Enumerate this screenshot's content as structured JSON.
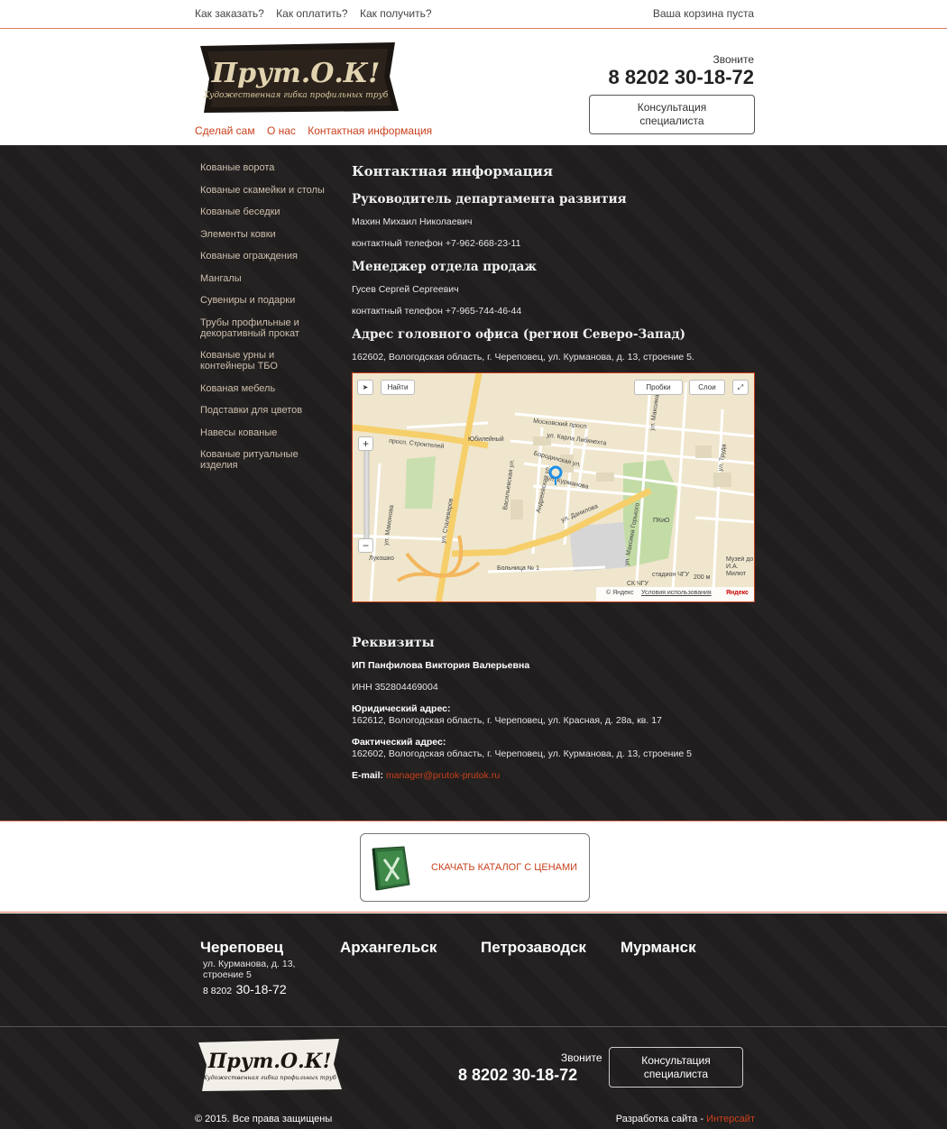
{
  "topbar": {
    "links": [
      "Как заказать?",
      "Как оплатить?",
      "Как получить?"
    ],
    "cart": "Ваша корзина пуста"
  },
  "header": {
    "logo_text": "Прут.О.К!",
    "logo_subtitle": "Художественная гибка профильных труб",
    "nav": [
      "Сделай сам",
      "О нас",
      "Контактная информация"
    ],
    "call_label": "Звоните",
    "phone": "8 8202 30-18-72",
    "consult_line1": "Консультация",
    "consult_line2": "специалиста"
  },
  "sidebar": {
    "items": [
      "Кованые ворота",
      "Кованые скамейки и столы",
      "Кованые беседки",
      "Элементы ковки",
      "Кованые ограждения",
      "Мангалы",
      "Сувениры и подарки",
      "Трубы профильные и декоративный прокат",
      "Кованые урны и контейнеры ТБО",
      "Кованая мебель",
      "Подставки для цветов",
      "Навесы кованые",
      "Кованые ритуальные изделия"
    ]
  },
  "content": {
    "title": "Контактная информация",
    "h_dev": "Руководитель департамента развития",
    "dev_name": "Махин Михаил Николаевич",
    "dev_phone": "контактный телефон +7-962-668-23-11",
    "h_sales": "Менеджер отдела продаж",
    "sales_name": "Гусев Сергей Сергеевич",
    "sales_phone": "контактный телефон +7-965-744-46-44",
    "h_address": "Адрес головного офиса (регион Северо-Запад)",
    "address": "162602, Вологодская область, г. Череповец, ул. Курманова, д. 13, строение 5.",
    "h_req": "Реквизиты",
    "req_name": "ИП Панфилова Виктория Валерьевна",
    "req_inn": "ИНН 352804469004",
    "req_legal_label": "Юридический адрес:",
    "req_legal": "162612, Вологодская область, г. Череповец, ул. Красная, д. 28а, кв. 17",
    "req_actual_label": "Фактический адрес:",
    "req_actual": "162602, Вологодская область, г. Череповец, ул. Курманова, д. 13, строение 5",
    "email_label": "E-mail:",
    "email": "manager@prutok-prutok.ru"
  },
  "map": {
    "find_btn": "Найти",
    "traffic_btn": "Пробки",
    "layers_btn": "Слои",
    "zoom_in": "+",
    "zoom_out": "−",
    "scale": "200 м",
    "copyright": "© Яндекс",
    "terms": "Условия использования",
    "brand": "Яндекс",
    "labels": {
      "str1": "просп. Строителей",
      "str2": "ул. Сталеваров",
      "str3": "Московский просп.",
      "str4": "ул. Карла Либкнехта",
      "str5": "Бородинская ул.",
      "str6": "ул. Курманова",
      "str7": "ул. Данилова",
      "str8": "ул. Максима Горького",
      "str9": "Васильевская ул.",
      "str10": "Андреевская ул.",
      "str11": "ул. Мамонова",
      "str12": "ул. Максима",
      "str13": "ул. Труда",
      "poi1": "Юбилейный",
      "poi2": "ПКиО",
      "poi3": "Больница № 1",
      "poi4": "Лукошко",
      "poi5": "стадион ЧГУ",
      "poi6": "СК ЧГУ",
      "poi7": "Музей до И.А. Милют"
    }
  },
  "catalog": {
    "label": "СКАЧАТЬ КАТАЛОГ С ЦЕНАМИ"
  },
  "footer": {
    "cities": [
      "Череповец",
      "Архангельск",
      "Петрозаводск",
      "Мурманск"
    ],
    "addr_line1": "ул. Курманова, д. 13,",
    "addr_line2": "строение 5",
    "phone_prefix": "8 8202",
    "phone_num": "30-18-72",
    "logo_text": "Прут.О.К!",
    "logo_subtitle": "Художественная гибка профильных труб",
    "call_label": "Звоните",
    "phone": "8 8202 30-18-72",
    "consult_line1": "Консультация",
    "consult_line2": "специалиста",
    "copyright": "© 2015. Все права защищены",
    "dev_label": "Разработка сайта - ",
    "dev_company": "Интерсайт"
  },
  "colors": {
    "accent": "#c9401c",
    "dark_bg": "#221f1f",
    "divider": "#e07a5f"
  }
}
